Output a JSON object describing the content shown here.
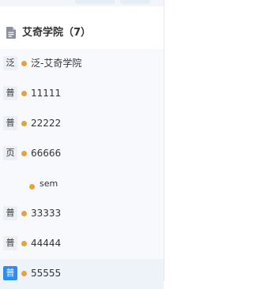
{
  "header": {
    "title": "艾奇学院（7）",
    "icon": "document-icon"
  },
  "colors": {
    "dot": "#e6a23c",
    "badge_bg": "#eceff3",
    "badge_primary_bg": "#2e8bf0",
    "row_bg": "#f7f9fc"
  },
  "items": [
    {
      "badge": "泛",
      "label": "泛-艾奇学院"
    },
    {
      "badge": "普",
      "label": "11111"
    },
    {
      "badge": "普",
      "label": "22222"
    },
    {
      "badge": "页",
      "label": "66666"
    },
    {
      "badge": "",
      "label": "sem"
    },
    {
      "badge": "普",
      "label": "33333"
    },
    {
      "badge": "普",
      "label": "44444"
    },
    {
      "badge": "普",
      "label": "55555"
    }
  ]
}
